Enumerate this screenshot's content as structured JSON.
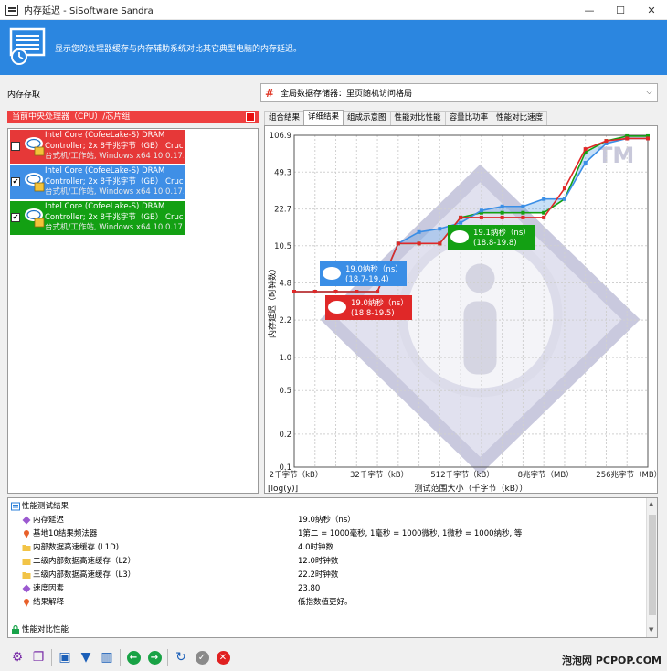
{
  "window": {
    "title": "内存延迟 - SiSoftware Sandra",
    "minimize": "—",
    "maximize": "☐",
    "close": "✕"
  },
  "banner": {
    "text": "显示您的处理器缓存与内存辅助系统对比其它典型电脑的内存延迟。"
  },
  "left": {
    "section_label": "内存存取",
    "header": "当前中央处理器（CPU）/芯片组",
    "devices": [
      {
        "line1": "Intel Core (CofeeLake-S) DRAM",
        "line2": "Controller; 2x 8千兆字节（GB） Cruc...",
        "line3": "台式机/工作站, Windows x64 10.0.17...",
        "checked": "",
        "color": "#e63838"
      },
      {
        "line1": "Intel Core (CofeeLake-S) DRAM",
        "line2": "Controller; 2x 8千兆字节（GB） Cruc...",
        "line3": "台式机/工作站, Windows x64 10.0.17...",
        "checked": "✔",
        "color": "#3f8fe6"
      },
      {
        "line1": "Intel Core (CofeeLake-S) DRAM",
        "line2": "Controller; 2x 8千兆字节（GB） Cruc...",
        "line3": "台式机/工作站, Windows x64 10.0.17...",
        "checked": "✔",
        "color": "#13a013"
      }
    ]
  },
  "context_select": {
    "value": "全局数据存储器：里页随机访问格局"
  },
  "tabs": [
    "组合结果",
    "详细结果",
    "组成示意图",
    "性能对比性能",
    "容量比功率",
    "性能对比速度"
  ],
  "chart_data": {
    "type": "line",
    "ylabel": "内存延迟（时钟数）",
    "xlabel": "测试范围大小（千字节（kB））",
    "scale_note": "[log(y)]",
    "y_ticks": [
      "106.9",
      "49.3",
      "22.7",
      "10.5",
      "4.8",
      "2.2",
      "1.0",
      "0.5",
      "0.2",
      "0.1"
    ],
    "x_ticks": [
      "2千字节（kB）",
      "32千字节（kB）",
      "512千字节（kB）",
      "8兆字节（MB）",
      "256兆字节（MB）"
    ],
    "x_log2_range": [
      1,
      18
    ],
    "y_range": [
      0.1,
      106.9
    ],
    "y_log": true,
    "series": [
      {
        "color": "#e02828",
        "points": [
          [
            1,
            4.0
          ],
          [
            2,
            4.0
          ],
          [
            3,
            4.0
          ],
          [
            4,
            4.0
          ],
          [
            5,
            4.0
          ],
          [
            6,
            11.0
          ],
          [
            7,
            11.0
          ],
          [
            8,
            11.0
          ],
          [
            9,
            19.0
          ],
          [
            10,
            19.0
          ],
          [
            11,
            19.0
          ],
          [
            12,
            19.0
          ],
          [
            13,
            19.0
          ],
          [
            14,
            35.0
          ],
          [
            15,
            80.0
          ],
          [
            16,
            95.0
          ],
          [
            17,
            100.0
          ],
          [
            18,
            100.0
          ]
        ]
      },
      {
        "color": "#3a8ee6",
        "points": [
          [
            1,
            4.0
          ],
          [
            2,
            4.0
          ],
          [
            3,
            4.0
          ],
          [
            4,
            4.0
          ],
          [
            5,
            4.0
          ],
          [
            6,
            11.0
          ],
          [
            7,
            14.0
          ],
          [
            8,
            15.0
          ],
          [
            9,
            17.0
          ],
          [
            10,
            22.0
          ],
          [
            11,
            24.0
          ],
          [
            12,
            24.0
          ],
          [
            13,
            28.0
          ],
          [
            14,
            28.0
          ],
          [
            15,
            60.0
          ],
          [
            16,
            90.0
          ],
          [
            17,
            100.0
          ],
          [
            18,
            100.0
          ]
        ]
      },
      {
        "color": "#13a013",
        "points": [
          [
            1,
            4.0
          ],
          [
            2,
            4.0
          ],
          [
            3,
            4.0
          ],
          [
            4,
            4.0
          ],
          [
            5,
            4.0
          ],
          [
            6,
            11.0
          ],
          [
            7,
            11.0
          ],
          [
            8,
            11.0
          ],
          [
            9,
            19.0
          ],
          [
            10,
            21.0
          ],
          [
            11,
            21.0
          ],
          [
            12,
            21.0
          ],
          [
            13,
            21.0
          ],
          [
            14,
            28.0
          ],
          [
            15,
            75.0
          ],
          [
            16,
            95.0
          ],
          [
            17,
            105.0
          ],
          [
            18,
            105.0
          ]
        ]
      }
    ],
    "annotations": [
      {
        "line1": "19.1纳秒（ns）",
        "line2": "(18.8-19.8)",
        "color": "#13a013"
      },
      {
        "line1": "19.0纳秒（ns）",
        "line2": "(18.7-19.4)",
        "color": "#3a8ee6"
      },
      {
        "line1": "19.0纳秒（ns）",
        "line2": "(18.8-19.5)",
        "color": "#e02828"
      }
    ],
    "tm_mark": "TM"
  },
  "results": {
    "header": "性能测试结果",
    "rows": [
      {
        "label": "内存延迟",
        "value": "19.0纳秒（ns）",
        "icon": "diamond-icon"
      },
      {
        "label": "基地10结果频法器",
        "value": "1第二 = 1000毫秒, 1毫秒 = 1000微秒, 1微秒 = 1000纳秒, 等",
        "icon": "pin-icon"
      },
      {
        "label": "内部数据高速缓存 (L1D)",
        "value": "4.0时钟数",
        "icon": "folder-icon"
      },
      {
        "label": "二级内部数据高速缓存（L2）",
        "value": "12.0时钟数",
        "icon": "folder-icon"
      },
      {
        "label": "三级内部数据高速缓存（L3）",
        "value": "22.2时钟数",
        "icon": "folder-icon"
      },
      {
        "label": "速度因素",
        "value": "23.80",
        "icon": "diamond-icon"
      },
      {
        "label": "结果解释",
        "value": "低指数值更好。",
        "icon": "pin-icon"
      }
    ],
    "footer": "性能对比性能"
  },
  "watermark": "泡泡网 PCPOP.COM"
}
